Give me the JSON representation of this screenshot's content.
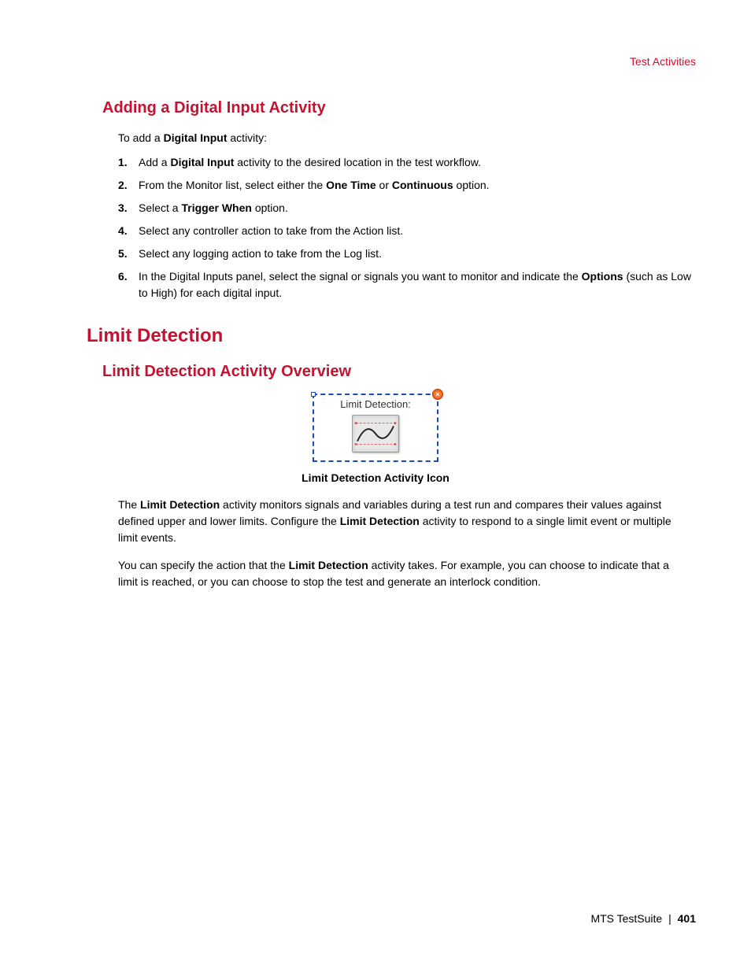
{
  "header": {
    "section_link": "Test Activities"
  },
  "section1": {
    "heading": "Adding a Digital Input Activity",
    "intro_pre": "To add a ",
    "intro_bold": "Digital Input",
    "intro_post": " activity:",
    "items": [
      {
        "num": "1.",
        "parts": [
          "Add a ",
          "Digital Input",
          " activity to the desired location in the test workflow."
        ]
      },
      {
        "num": "2.",
        "parts": [
          "From the Monitor list, select either the ",
          "One Time",
          " or ",
          "Continuous",
          " option."
        ]
      },
      {
        "num": "3.",
        "parts": [
          "Select a ",
          "Trigger When",
          " option."
        ]
      },
      {
        "num": "4.",
        "parts": [
          "Select any controller action to take from the Action list."
        ]
      },
      {
        "num": "5.",
        "parts": [
          "Select any logging action to take from the Log list."
        ]
      },
      {
        "num": "6.",
        "parts": [
          "In the Digital Inputs panel, select the signal or signals you want to monitor and indicate the ",
          "Options",
          " (such as Low to High) for each digital input."
        ]
      }
    ]
  },
  "section2": {
    "heading": "Limit Detection",
    "sub_heading": "Limit Detection Activity Overview",
    "icon_label": "Limit Detection:",
    "icon_caption": "Limit Detection Activity Icon",
    "para1": {
      "parts": [
        "The ",
        "Limit Detection",
        " activity monitors signals and variables during a test run and compares their values against defined upper and lower limits. Configure the ",
        "Limit Detection",
        " activity to respond to a single limit event or multiple limit events."
      ]
    },
    "para2": {
      "parts": [
        "You can specify the action that the ",
        "Limit Detection",
        " activity takes. For example, you can choose to indicate that a limit is reached, or you can choose to stop the test and generate an interlock condition."
      ]
    }
  },
  "footer": {
    "product": "MTS TestSuite",
    "sep": "|",
    "page": "401"
  }
}
